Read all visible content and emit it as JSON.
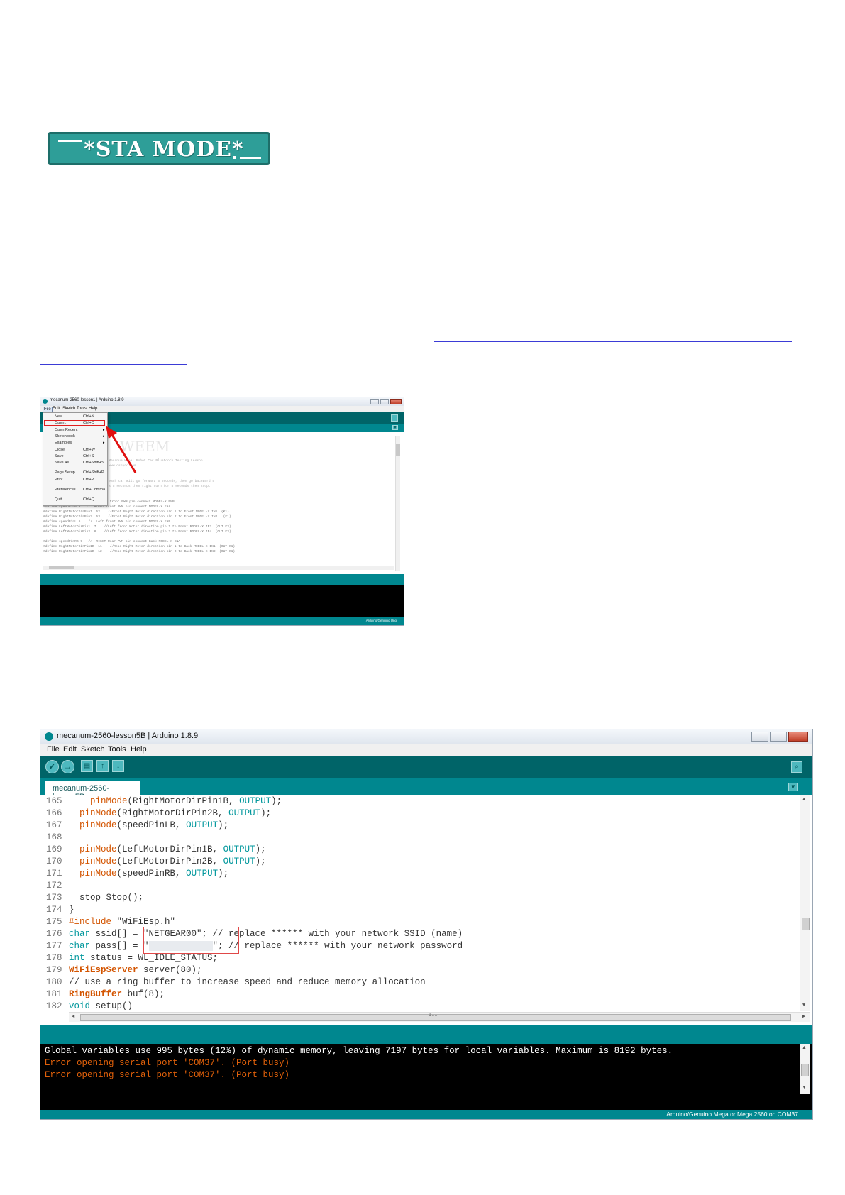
{
  "banner": {
    "text": "*STA MODE*"
  },
  "screenshot1": {
    "title": "mecanum-2560-lesson1 | Arduino 1.8.9",
    "menu": [
      "File",
      "Edit",
      "Sketch",
      "Tools",
      "Help"
    ],
    "file_menu": [
      {
        "label": "New",
        "accel": "Ctrl+N"
      },
      {
        "label": "Open...",
        "accel": "Ctrl+O",
        "highlighted": true
      },
      {
        "label": "Open Recent",
        "accel": ""
      },
      {
        "label": "Sketchbook",
        "accel": ""
      },
      {
        "label": "Examples",
        "accel": ""
      },
      {
        "label": "Close",
        "accel": "Ctrl+W"
      },
      {
        "label": "Save",
        "accel": "Ctrl+S"
      },
      {
        "label": "Save As...",
        "accel": "Ctrl+Shift+S"
      },
      {
        "label": "Page Setup",
        "accel": "Ctrl+Shift+P"
      },
      {
        "label": "Print",
        "accel": "Ctrl+P"
      },
      {
        "label": "Preferences",
        "accel": "Ctrl+Comma"
      },
      {
        "label": "Quit",
        "accel": "Ctrl+Q"
      }
    ],
    "code_lines": [
      "#define TURN_SPEED 110    // Left front PWM pin connect MODEL-X ENB",
      "#define speedPinB 3   //  RIGHT front PWM pin connect MODEL-X ENA",
      "#define RightMotorDirPin1  52    //Front Right Motor direction pin 1 to Front MODEL-X IN1  (K1)",
      "#define RightMotorDirPin2  53    //Front Right Motor direction pin 2 to Front MODEL-X IN2   (K1)",
      "#define speedPinL 6    //  Left front PWM pin connect MODEL-X ENB",
      "#define LeftMotorDirPin1  7    //Left front Motor direction pin 1 to Front MODEL-X IN3  (OUT K3)",
      "#define LeftMotorDirPin2  8    //Left front Motor direction pin 2 to Front MODEL-X IN4  (OUT K3)",
      "",
      "#define speedPinRB 9   //  RIGHT Rear PWM pin connect Back MODEL-X ENA",
      "#define RightMotorDirPin1B  11    //Rear Right Motor direction pin 1 to Back MODEL-X IN1  (OUT K1)",
      "#define RightMotorDirPin2B  12    //Rear Right Motor direction pin 2 to Back MODEL-X IN2  (OUT K1)"
    ],
    "status": "Arduino/Genuino Uno"
  },
  "screenshot2": {
    "title": "mecanum-2560-lesson5B | Arduino 1.8.9",
    "menu": [
      "File",
      "Edit",
      "Sketch",
      "Tools",
      "Help"
    ],
    "tab": "mecanum-2560-lesson5B",
    "code": [
      {
        "n": "165",
        "t": "    pinMode(RightMotorDirPin1B, OUTPUT);"
      },
      {
        "n": "166",
        "t": "  pinMode(RightMotorDirPin2B, OUTPUT);"
      },
      {
        "n": "167",
        "t": "  pinMode(speedPinLB, OUTPUT);"
      },
      {
        "n": "168",
        "t": ""
      },
      {
        "n": "169",
        "t": "  pinMode(LeftMotorDirPin1B, OUTPUT);"
      },
      {
        "n": "170",
        "t": "  pinMode(LeftMotorDirPin2B, OUTPUT);"
      },
      {
        "n": "171",
        "t": "  pinMode(speedPinRB, OUTPUT);"
      },
      {
        "n": "172",
        "t": ""
      },
      {
        "n": "173",
        "t": "  stop_Stop();"
      },
      {
        "n": "174",
        "t": "}"
      },
      {
        "n": "175",
        "t": "#include \"WiFiEsp.h\""
      },
      {
        "n": "176",
        "t": "char ssid[] = \"NETGEAR00\"; // replace ****** with your network SSID (name)"
      },
      {
        "n": "177",
        "t": "char pass[] = \"            \"; // replace ****** with your network password"
      },
      {
        "n": "178",
        "t": "int status = WL_IDLE_STATUS;"
      },
      {
        "n": "179",
        "t": "WiFiEspServer server(80);"
      },
      {
        "n": "180",
        "t": "// use a ring buffer to increase speed and reduce memory allocation"
      },
      {
        "n": "181",
        "t": "RingBuffer buf(8);"
      },
      {
        "n": "182",
        "t": "void setup()"
      }
    ],
    "console": [
      {
        "text": "Global variables use 995 bytes (12%) of dynamic memory, leaving 7197 bytes for local variables. Maximum is 8192 bytes.",
        "color": "#ffffff"
      },
      {
        "text": "Error opening serial port 'COM37'. (Port busy)",
        "color": "#e0600a"
      },
      {
        "text": "Error opening serial port 'COM37'. (Port busy)",
        "color": "#e0600a"
      }
    ],
    "status": "Arduino/Genuino Mega or Mega 2560 on COM37",
    "scroll_marker": "III"
  }
}
